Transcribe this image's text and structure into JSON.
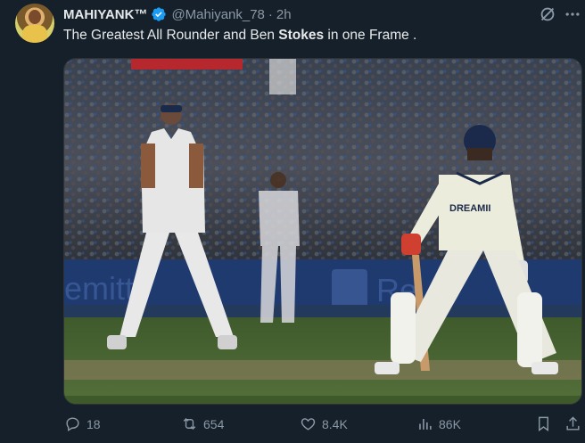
{
  "author": {
    "name": "MAHIYANK™",
    "handle": "@Mahiyank_78",
    "separator": "·",
    "time": "2h",
    "verified_color": "#1d9bf0"
  },
  "tweet": {
    "text_before": "The Greatest All Rounder and Ben ",
    "text_bold": "Stokes",
    "text_after": " in one Frame  ."
  },
  "media": {
    "jersey_text": "DREAMII",
    "board_text_left": "emitt",
    "board_text_right": "Re"
  },
  "actions": {
    "replies": "18",
    "reposts": "654",
    "likes": "8.4K",
    "views": "86K"
  },
  "icons": [
    "verified-icon",
    "grok-icon",
    "more-icon",
    "reply-icon",
    "repost-icon",
    "like-icon",
    "views-icon",
    "bookmark-icon",
    "share-icon"
  ]
}
